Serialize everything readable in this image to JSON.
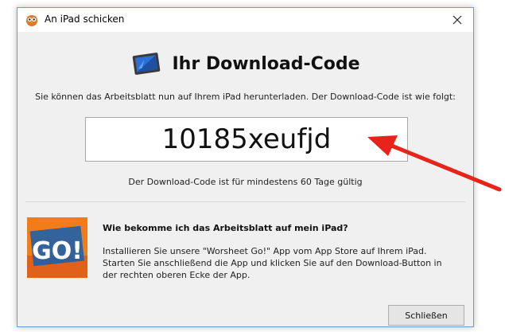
{
  "window": {
    "title": "An iPad schicken",
    "close_icon": "close-icon",
    "app_icon": "owl-app-icon"
  },
  "content": {
    "heading": "Ihr Download-Code",
    "heading_icon": "ipad-icon",
    "intro": "Sie können das Arbeitsblatt nun auf Ihrem iPad herunterladen. Der Download-Code ist wie folgt:",
    "code": "10185xeufjd",
    "validity": "Der Download-Code ist für mindestens 60 Tage gültig"
  },
  "help": {
    "logo_text": "GO!",
    "question": "Wie bekomme ich das Arbeitsblatt auf mein iPad?",
    "instructions": "Installieren Sie unsere \"Worsheet Go!\" App vom App Store auf Ihrem iPad. Starten Sie anschließend die App und klicken Sie auf den Download-Button in der rechten oberen Ecke der App."
  },
  "footer": {
    "close_label": "Schließen"
  },
  "colors": {
    "arrow": "#e8231b",
    "logo_orange": "#f07d1a",
    "logo_blue": "#1f5fa8",
    "window_border": "#6e9ad6"
  }
}
